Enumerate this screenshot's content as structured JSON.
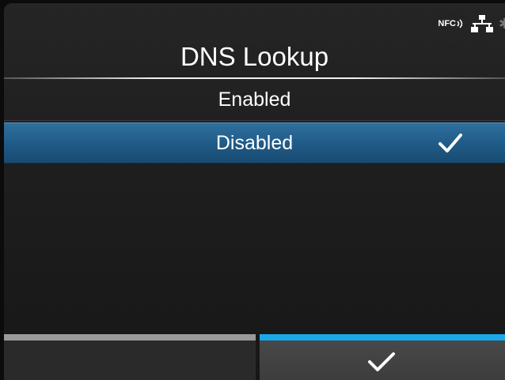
{
  "header": {
    "title": "DNS Lookup",
    "status_icons": {
      "nfc_label": "NFC",
      "nfc": "nfc-icon",
      "network": "network-icon",
      "bluetooth": "bluetooth-icon"
    }
  },
  "options": [
    {
      "label": "Enabled",
      "selected": false
    },
    {
      "label": "Disabled",
      "selected": true,
      "icon": "check-icon"
    }
  ],
  "footer": {
    "left_button": {
      "label": ""
    },
    "right_button": {
      "icon": "check-icon"
    }
  },
  "colors": {
    "selection": "#2a6896",
    "confirm_accent": "#1aa8e8",
    "back_accent": "#9a9a9a"
  }
}
